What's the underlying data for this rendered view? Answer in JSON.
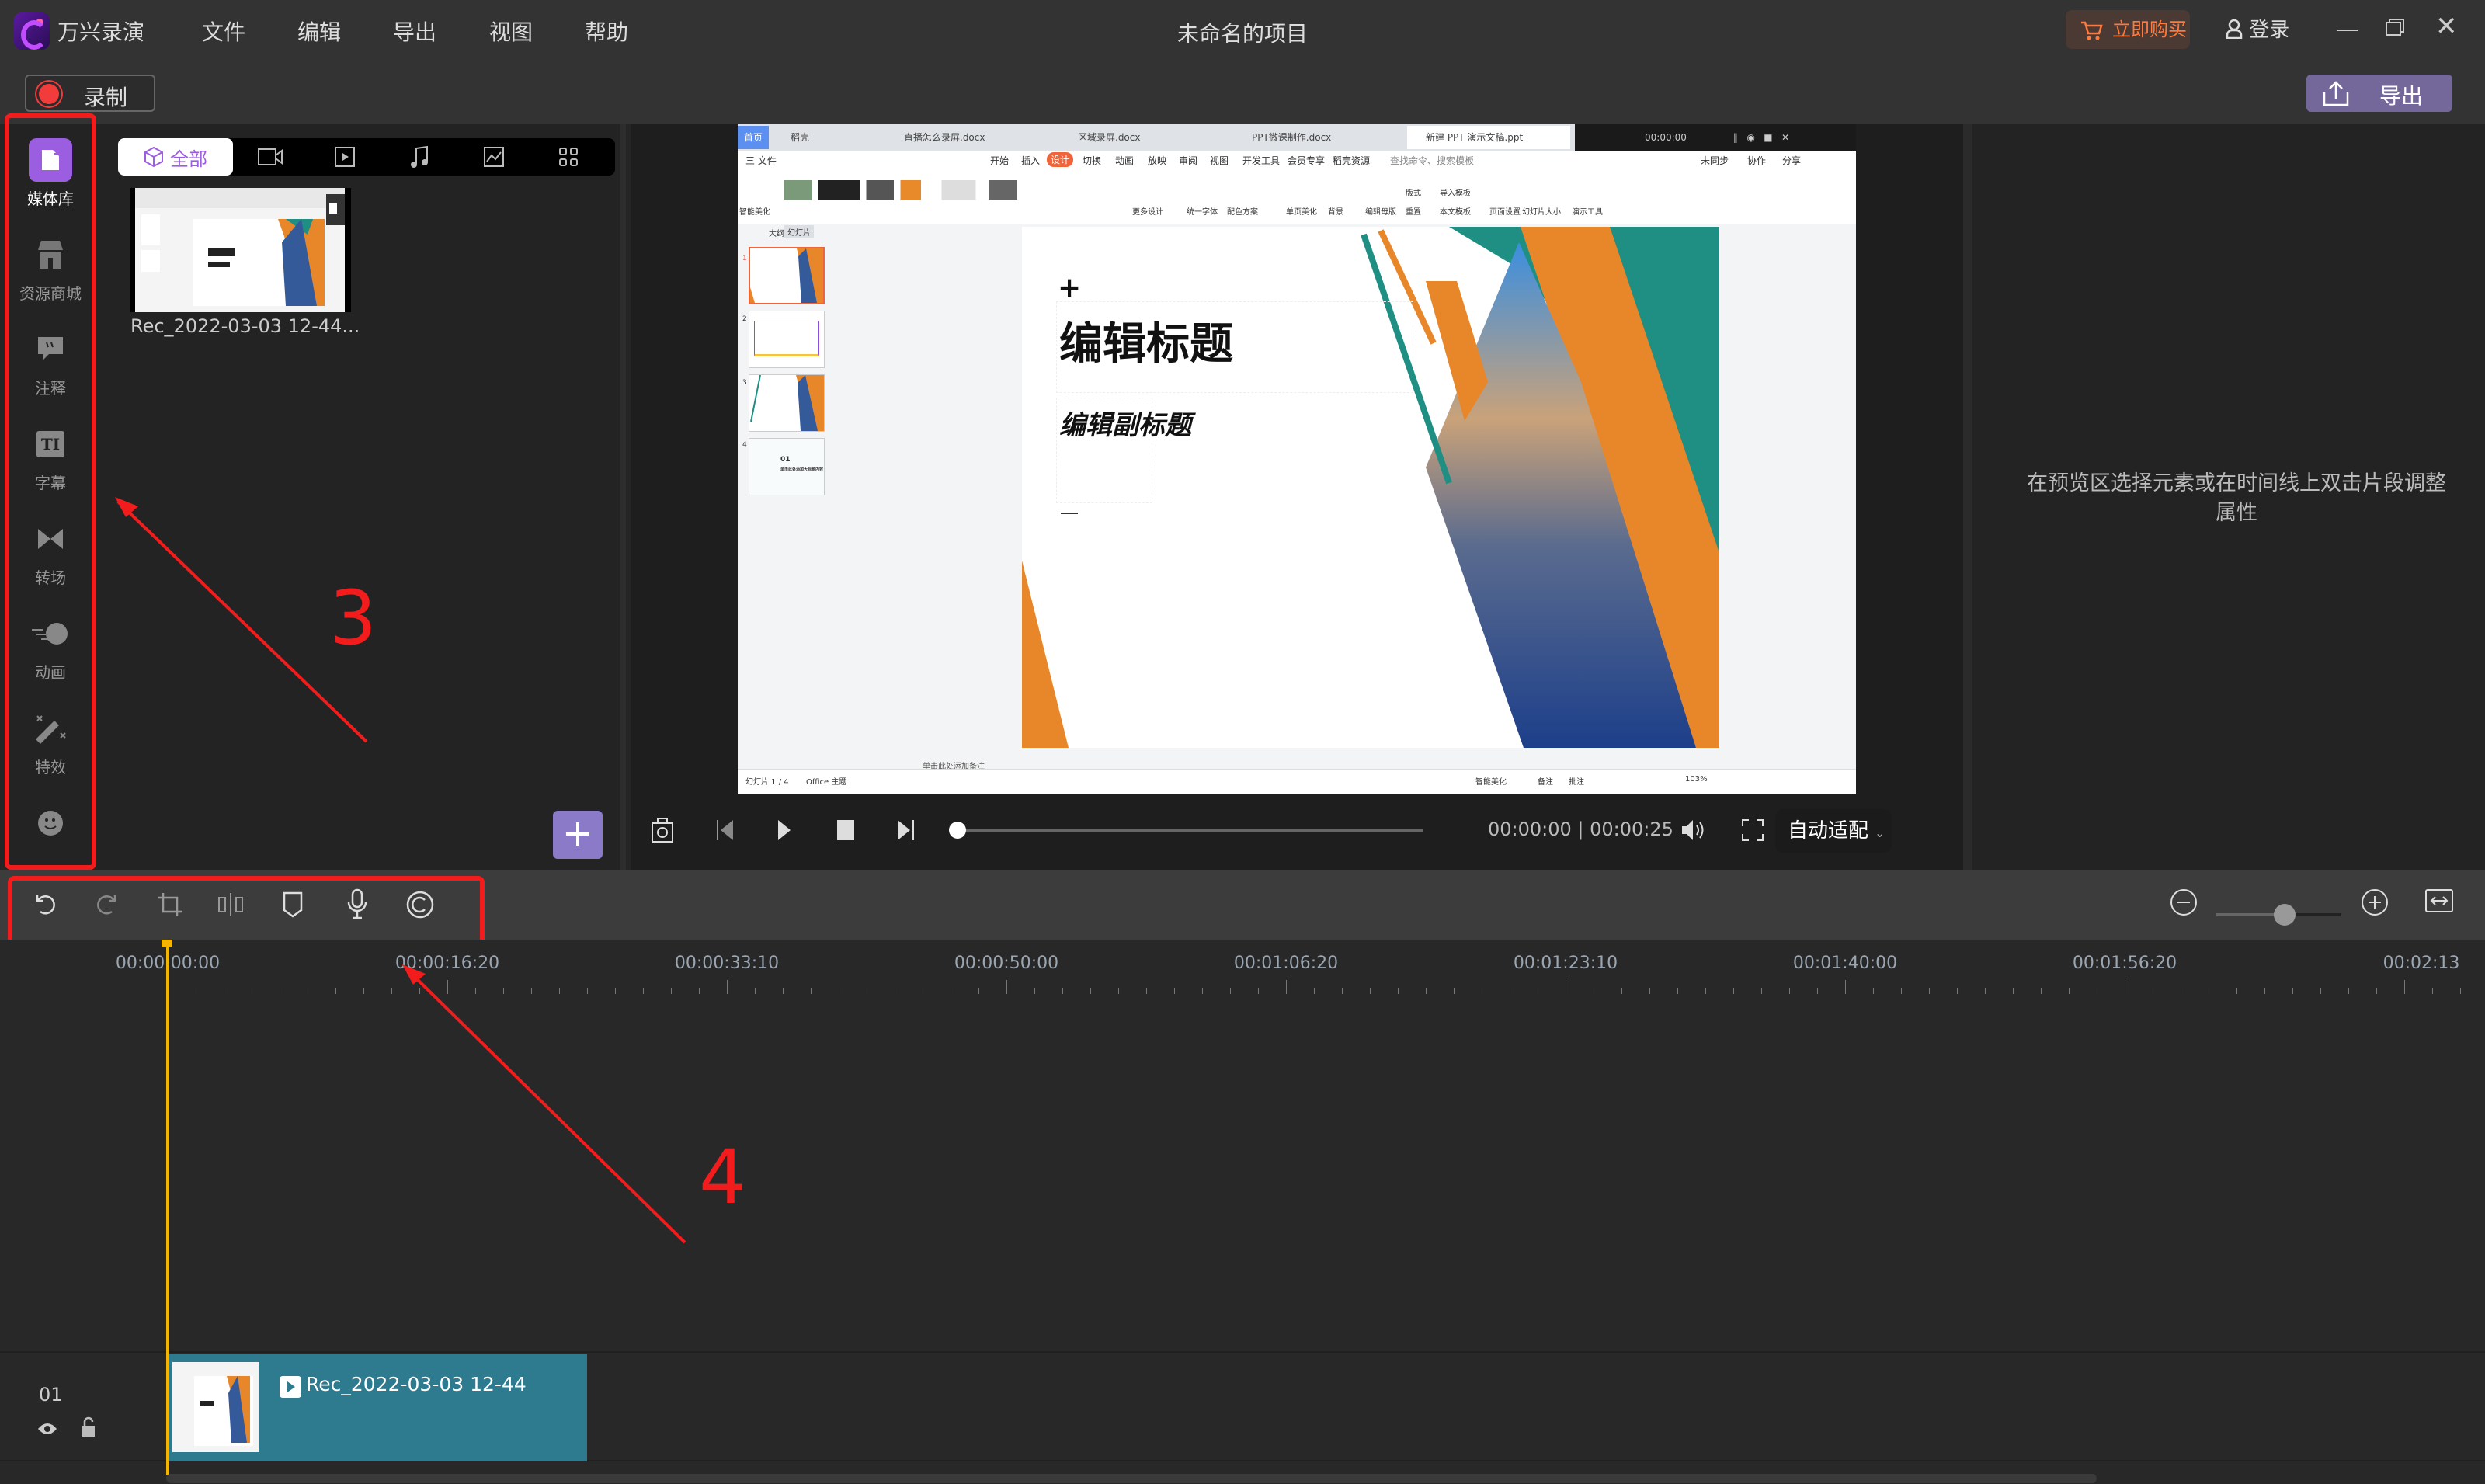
{
  "app": {
    "name": "万兴录演",
    "project_title": "未命名的项目",
    "menu": [
      "文件",
      "编辑",
      "导出",
      "视图",
      "帮助"
    ],
    "buy_label": "立即购买",
    "login_label": "登录",
    "record_label": "录制",
    "export_label": "导出",
    "accent": "#9c5ee0",
    "export_color": "#74689b",
    "buy_color": "#ff7a3c"
  },
  "sidebar": {
    "items": [
      {
        "label": "媒体库",
        "icon": "folder-icon",
        "active": true
      },
      {
        "label": "资源商城",
        "icon": "store-icon"
      },
      {
        "label": "注释",
        "icon": "comment-icon"
      },
      {
        "label": "字幕",
        "icon": "caption-icon"
      },
      {
        "label": "转场",
        "icon": "transition-icon"
      },
      {
        "label": "动画",
        "icon": "animation-icon"
      },
      {
        "label": "特效",
        "icon": "magic-wand-icon"
      },
      {
        "label": "",
        "icon": "sticker-icon"
      }
    ]
  },
  "media": {
    "tabs": [
      {
        "label": "全部",
        "icon": "cube-icon"
      },
      {
        "icon": "camera-icon"
      },
      {
        "icon": "video-icon"
      },
      {
        "icon": "music-icon"
      },
      {
        "icon": "image-icon"
      },
      {
        "icon": "grid-icon"
      }
    ],
    "items": [
      {
        "name": "Rec_2022-03-03 12-44..."
      }
    ],
    "add_label": "+"
  },
  "recording": {
    "tabs": [
      "首页",
      "稻壳",
      "直播怎么录屏.docx",
      "区域录屏.docx",
      "PPT微课制作.docx",
      "新建 PPT 演示文稿.ppt"
    ],
    "rec_timer": "00:00:00",
    "menu": [
      "三 文件",
      "开始",
      "插入",
      "设计",
      "切换",
      "动画",
      "放映",
      "审阅",
      "视图",
      "开发工具",
      "会员专享",
      "稻壳资源"
    ],
    "search": "查找命令、搜索模板",
    "right_menu": [
      "未同步",
      "协作",
      "分享"
    ],
    "ribbon": [
      "智能美化",
      "更多设计",
      "统一字体",
      "配色方案",
      "单页美化",
      "背景",
      "编辑母版",
      "版式",
      "导入模板",
      "重置",
      "本文模板",
      "页面设置",
      "幻灯片大小",
      "演示工具"
    ],
    "panel_tabs": [
      "大纲",
      "幻灯片"
    ],
    "slide_numbers": [
      "1",
      "2",
      "3",
      "4"
    ],
    "slide4": {
      "num": "01",
      "title": "单击此处添加大标题内容"
    },
    "slide_title": "编辑标题",
    "slide_subtitle": "编辑副标题",
    "notes": "单击此处添加备注",
    "status_left": [
      "幻灯片 1 / 4",
      "Office 主题"
    ],
    "status_right": [
      "智能美化",
      "备注",
      "批注",
      "103%"
    ]
  },
  "player": {
    "current": "00:00:00",
    "total": "00:00:25",
    "fit_label": "自动适配",
    "progress": 0
  },
  "properties": {
    "hint": "在预览区选择元素或在时间线上双击片段调整属性"
  },
  "timeline": {
    "tools": [
      "undo-icon",
      "redo-icon",
      "crop-icon",
      "split-icon",
      "marker-icon",
      "microphone-icon",
      "copyright-icon"
    ],
    "zoom_level": 0.55,
    "ruler": [
      "00:00:00:00",
      "00:00:16:20",
      "00:00:33:10",
      "00:00:50:00",
      "00:01:06:20",
      "00:01:23:10",
      "00:01:40:00",
      "00:01:56:20",
      "00:02:13"
    ],
    "tracks": [
      {
        "number": "01",
        "clip": "Rec_2022-03-03 12-44",
        "clip_color": "#2e7a8e"
      }
    ],
    "playhead_color": "#f5b400"
  },
  "annotations": [
    "3",
    "4"
  ]
}
